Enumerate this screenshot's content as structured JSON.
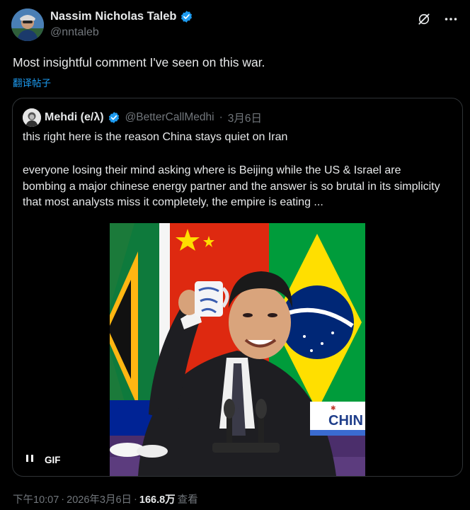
{
  "author": {
    "display_name": "Nassim Nicholas Taleb",
    "handle": "@nntaleb"
  },
  "tweet": {
    "text": "Most insightful comment I've seen on this war.",
    "translate_label": "翻译帖子"
  },
  "quote": {
    "display_name": "Mehdi (e/λ)",
    "handle": "@BetterCallMedhi",
    "separator": "·",
    "date": "3月6日",
    "line1": "this right here is the reason China stays quiet on Iran",
    "paragraph": "everyone losing their mind asking where is Beijing while the US & Israel are bombing a major chinese energy partner and the answer is so brutal in its simplicity that most analysts miss it completely, the empire is eating  ...",
    "media": {
      "gif_label": "GIF",
      "sign_text": "CHIN"
    }
  },
  "meta": {
    "time": "下午10:07",
    "separator": "·",
    "date": "2026年3月6日",
    "separator2": "·",
    "views_count": "166.8万",
    "views_label": "查看"
  },
  "colors": {
    "background": "#000000",
    "text_primary": "#e7e9ea",
    "text_secondary": "#71767b",
    "accent": "#1d9bf0",
    "border": "#2f3336"
  },
  "icons": [
    "verified-badge-icon",
    "grok-icon",
    "more-icon",
    "pause-icon"
  ]
}
